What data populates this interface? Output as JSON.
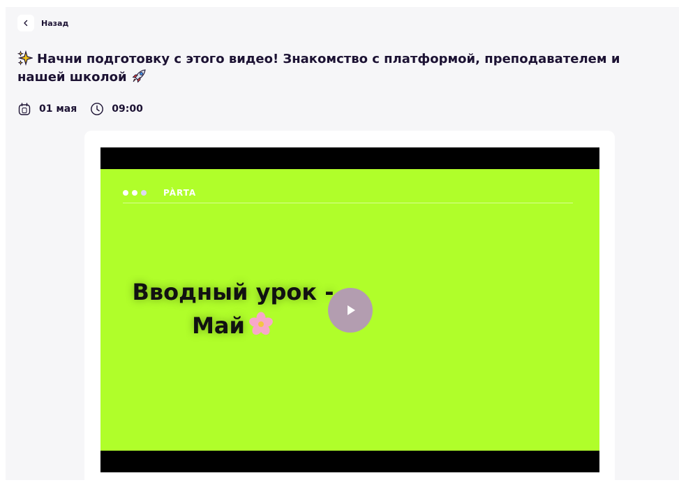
{
  "nav": {
    "back_label": "Назад"
  },
  "lesson": {
    "title": "Начни подготовку с этого видео! Знакомство с платформой, преподавателем и нашей школой",
    "date": "01 мая",
    "time": "09:00"
  },
  "video": {
    "brand": "PÀRTA",
    "overlay_line1": "Вводный урок -",
    "overlay_line2": "Май",
    "background_color": "#b0fe2a",
    "play_button_color": "#b48cc8"
  },
  "icons": {
    "back": "chevron-left-icon",
    "title_start": "sparkles-icon",
    "title_end": "rocket-icon",
    "date": "calendar-icon",
    "time": "clock-icon",
    "flower": "cherry-blossom-icon",
    "play": "play-icon"
  }
}
